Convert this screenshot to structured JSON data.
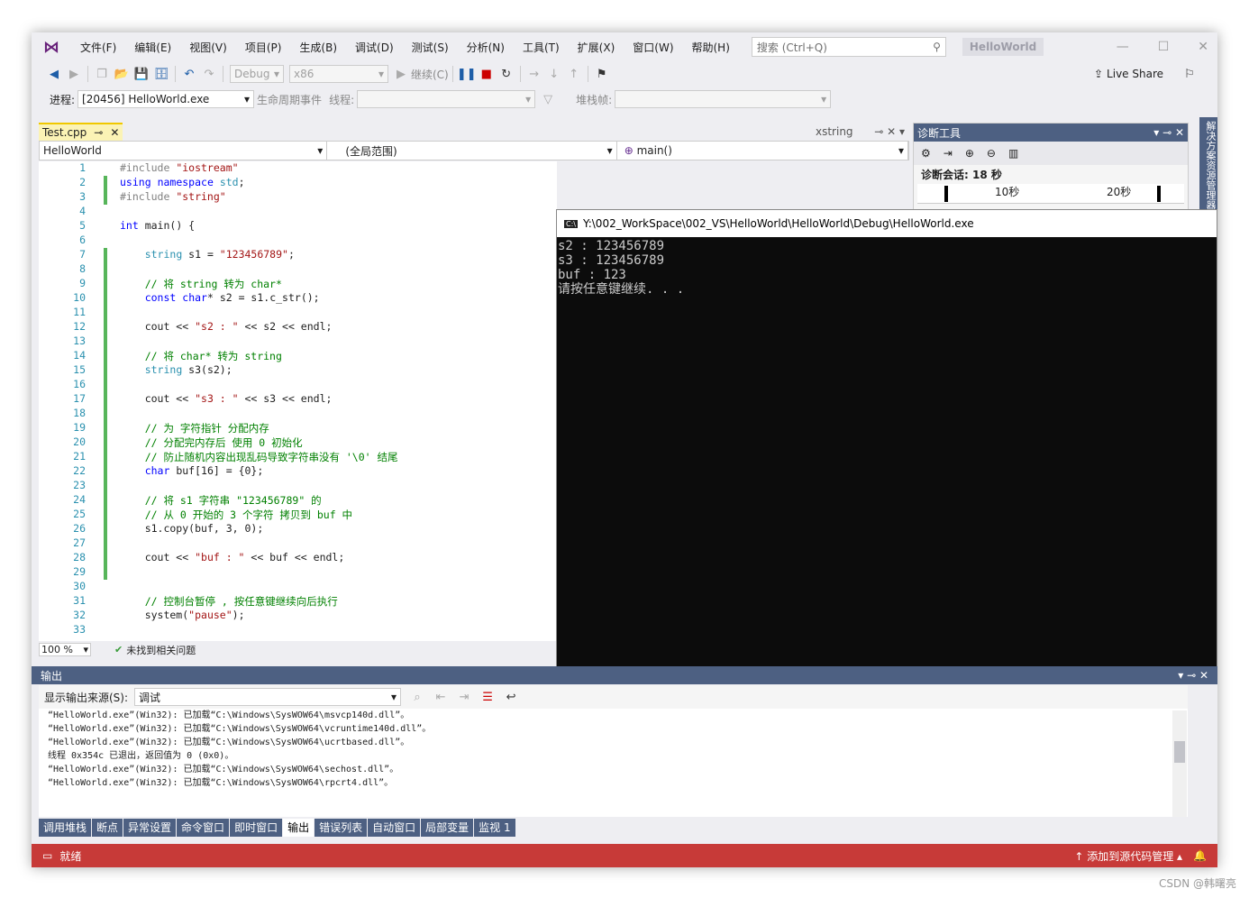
{
  "menu": [
    "文件(F)",
    "编辑(E)",
    "视图(V)",
    "项目(P)",
    "生成(B)",
    "调试(D)",
    "测试(S)",
    "分析(N)",
    "工具(T)",
    "扩展(X)",
    "窗口(W)",
    "帮助(H)"
  ],
  "search_placeholder": "搜索 (Ctrl+Q)",
  "solution_name": "HelloWorld",
  "toolbar": {
    "config": "Debug",
    "platform": "x86",
    "continue": "继续(C)",
    "live_share": "Live Share"
  },
  "debugbar": {
    "process_label": "进程:",
    "process_value": "[20456] HelloWorld.exe",
    "lifecycle": "生命周期事件",
    "thread_label": "线程:",
    "stack_label": "堆栈帧:"
  },
  "editor": {
    "tab": "Test.cpp",
    "nav_project": "HelloWorld",
    "nav_scope": "(全局范围)",
    "nav_func": "main()",
    "zoom": "100 %",
    "issues": "未找到相关问题",
    "xstring_tab": "xstring"
  },
  "code": [
    "#include \"iostream\"",
    "using namespace std;",
    "#include \"string\"",
    "",
    "int main() {",
    "",
    "    string s1 = \"123456789\";",
    "",
    "    // 将 string 转为 char*",
    "    const char* s2 = s1.c_str();",
    "",
    "    cout << \"s2 : \" << s2 << endl;",
    "",
    "    // 将 char* 转为 string",
    "    string s3(s2);",
    "",
    "    cout << \"s3 : \" << s3 << endl;",
    "",
    "    // 为 字符指针 分配内存",
    "    // 分配完内存后 使用 0 初始化",
    "    // 防止随机内容出现乱码导致字符串没有 '\\0' 结尾",
    "    char buf[16] = {0};",
    "",
    "    // 将 s1 字符串 \"123456789\" 的",
    "    // 从 0 开始的 3 个字符 拷贝到 buf 中",
    "    s1.copy(buf, 3, 0);",
    "",
    "    cout << \"buf : \" << buf << endl;",
    "",
    "",
    "    // 控制台暂停 , 按任意键继续向后执行",
    "    system(\"pause\");",
    ""
  ],
  "console": {
    "title": "Y:\\002_WorkSpace\\002_VS\\HelloWorld\\HelloWorld\\Debug\\HelloWorld.exe",
    "lines": [
      "s2 : 123456789",
      "s3 : 123456789",
      "buf : 123",
      "请按任意键继续. . ."
    ]
  },
  "diag": {
    "title": "诊断工具",
    "session": "诊断会话: 18 秒",
    "t1": "10秒",
    "t2": "20秒",
    "side": "解决方案资源管理器"
  },
  "output": {
    "title": "输出",
    "source_label": "显示输出来源(S):",
    "source_value": "调试",
    "lines": [
      "“HelloWorld.exe”(Win32): 已加载“C:\\Windows\\SysWOW64\\msvcp140d.dll”。",
      "“HelloWorld.exe”(Win32): 已加载“C:\\Windows\\SysWOW64\\vcruntime140d.dll”。",
      "“HelloWorld.exe”(Win32): 已加载“C:\\Windows\\SysWOW64\\ucrtbased.dll”。",
      "线程 0x354c 已退出，返回值为 0 (0x0)。",
      "“HelloWorld.exe”(Win32): 已加载“C:\\Windows\\SysWOW64\\sechost.dll”。",
      "“HelloWorld.exe”(Win32): 已加载“C:\\Windows\\SysWOW64\\rpcrt4.dll”。"
    ]
  },
  "bottom_tabs": [
    "调用堆栈",
    "断点",
    "异常设置",
    "命令窗口",
    "即时窗口",
    "输出",
    "错误列表",
    "自动窗口",
    "局部变量",
    "监视 1"
  ],
  "status": {
    "ready": "就绪",
    "source_control": "添加到源代码管理"
  },
  "watermark": "CSDN @韩曙亮"
}
